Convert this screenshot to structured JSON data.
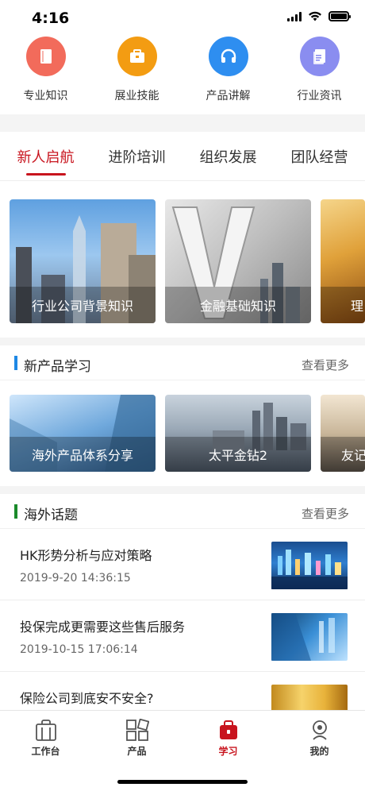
{
  "status": {
    "time": "4:16"
  },
  "quick": [
    {
      "label": "专业知识",
      "color": "#f26b5b",
      "icon": "book-icon"
    },
    {
      "label": "展业技能",
      "color": "#f39c12",
      "icon": "briefcase-icon"
    },
    {
      "label": "产品讲解",
      "color": "#2e8ef0",
      "icon": "headphones-icon"
    },
    {
      "label": "行业资讯",
      "color": "#8a8df0",
      "icon": "document-icon"
    }
  ],
  "tabs": [
    "新人启航",
    "进阶培训",
    "组织发展",
    "团队经营"
  ],
  "featured": [
    {
      "caption": "行业公司背景知识"
    },
    {
      "caption": "金融基础知识"
    },
    {
      "caption": "理"
    }
  ],
  "new_products": {
    "title": "新产品学习",
    "more": "查看更多",
    "accent": "#1e88e5",
    "cards": [
      {
        "caption": "海外产品体系分享"
      },
      {
        "caption": "太平金钻2"
      },
      {
        "caption": "友记"
      }
    ]
  },
  "overseas": {
    "title": "海外话题",
    "more": "查看更多",
    "accent": "#1a8a2a",
    "articles": [
      {
        "title": "HK形势分析与应对策略",
        "date": "2019-9-20 14:36:15"
      },
      {
        "title": "投保完成更需要这些售后服务",
        "date": "2019-10-15 17:06:14"
      },
      {
        "title": "保险公司到底安不安全?",
        "date": ""
      }
    ]
  },
  "nav": [
    {
      "label": "工作台",
      "icon": "bag-icon"
    },
    {
      "label": "产品",
      "icon": "grid-icon"
    },
    {
      "label": "学习",
      "icon": "study-icon",
      "active": true
    },
    {
      "label": "我的",
      "icon": "profile-icon"
    }
  ],
  "brand_red": "#c8141e"
}
